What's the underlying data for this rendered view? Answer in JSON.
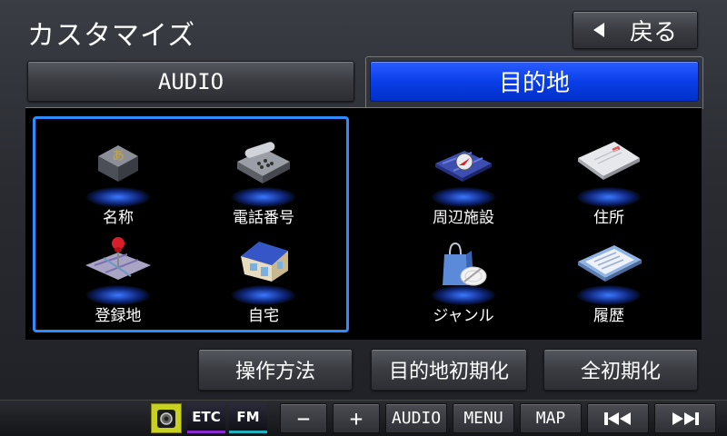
{
  "title": "カスタマイズ",
  "back_button": "戻る",
  "tabs": {
    "audio": "AUDIO",
    "destination": "目的地"
  },
  "items": {
    "name": "名称",
    "phone": "電話番号",
    "nearby": "周辺施設",
    "address": "住所",
    "registered": "登録地",
    "home": "自宅",
    "genre": "ジャンル",
    "history": "履歴"
  },
  "bottom_buttons": {
    "howto": "操作方法",
    "dest_init": "目的地初期化",
    "all_init": "全初期化"
  },
  "status_bar": {
    "etc": "ETC",
    "fm": "FM",
    "minus": "−",
    "plus": "+",
    "audio": "AUDIO",
    "menu": "MENU",
    "map": "MAP"
  },
  "colors": {
    "accent_blue": "#0a3ee8",
    "frame_blue": "#2e8cff"
  }
}
